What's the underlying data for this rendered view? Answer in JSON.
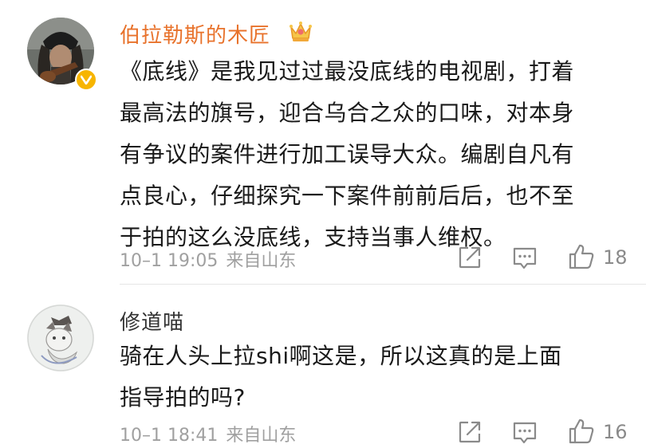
{
  "comments": [
    {
      "username": "伯拉勒斯的木匠",
      "verified": true,
      "badge_color": "#f7b500",
      "username_color": "#e8722b",
      "crown_icon": "crown-icon",
      "text_lines": [
        "《底线》是我见过过最没底线的电视剧，打着",
        "最高法的旗号，迎合乌合之众的口味，对本身",
        "有争议的案件进行加工误导大众。编剧自凡有",
        "点良心，仔细探究一下案件前前后后，也不至",
        "于拍的这么没底线，支持当事人维权。"
      ],
      "timestamp": "10–1 19:05",
      "source": "来自山东",
      "likes": "18"
    },
    {
      "username": "修道喵",
      "verified": false,
      "username_color": "#333333",
      "text_lines": [
        "骑在人头上拉shi啊这是，所以这真的是上面",
        "指导拍的吗?"
      ],
      "timestamp": "10–1 18:41",
      "source": "来自山东",
      "likes": "16"
    }
  ]
}
